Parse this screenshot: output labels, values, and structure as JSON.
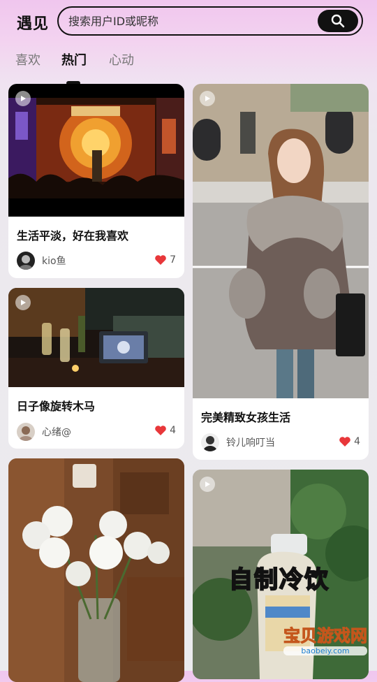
{
  "header": {
    "title": "遇见",
    "search_placeholder": "搜索用户ID或昵称"
  },
  "tabs": [
    {
      "label": "喜欢",
      "active": false
    },
    {
      "label": "热门",
      "active": true
    },
    {
      "label": "心动",
      "active": false
    }
  ],
  "feed": {
    "left": [
      {
        "title": "生活平淡，好在我喜欢",
        "author": "kio鱼",
        "likes": "7",
        "is_video": true
      },
      {
        "title": "日子像旋转木马",
        "author": "心绪@",
        "likes": "4",
        "is_video": true
      },
      {
        "title": "",
        "author": "",
        "likes": "",
        "is_video": false
      }
    ],
    "right": [
      {
        "title": "完美精致女孩生活",
        "author": "铃儿响叮当",
        "likes": "4",
        "is_video": true
      },
      {
        "title": "",
        "author": "",
        "likes": "",
        "is_video": true,
        "overlay_text": "自制冷饮"
      }
    ]
  },
  "watermark": {
    "text": "宝贝游戏网",
    "domain": "baobeiy.com"
  },
  "colors": {
    "accent": "#111111",
    "like": "#e8373a",
    "background_top": "#f0c6ee"
  },
  "icons": {
    "search": "search-icon",
    "play": "play-icon",
    "like": "heart-icon"
  }
}
